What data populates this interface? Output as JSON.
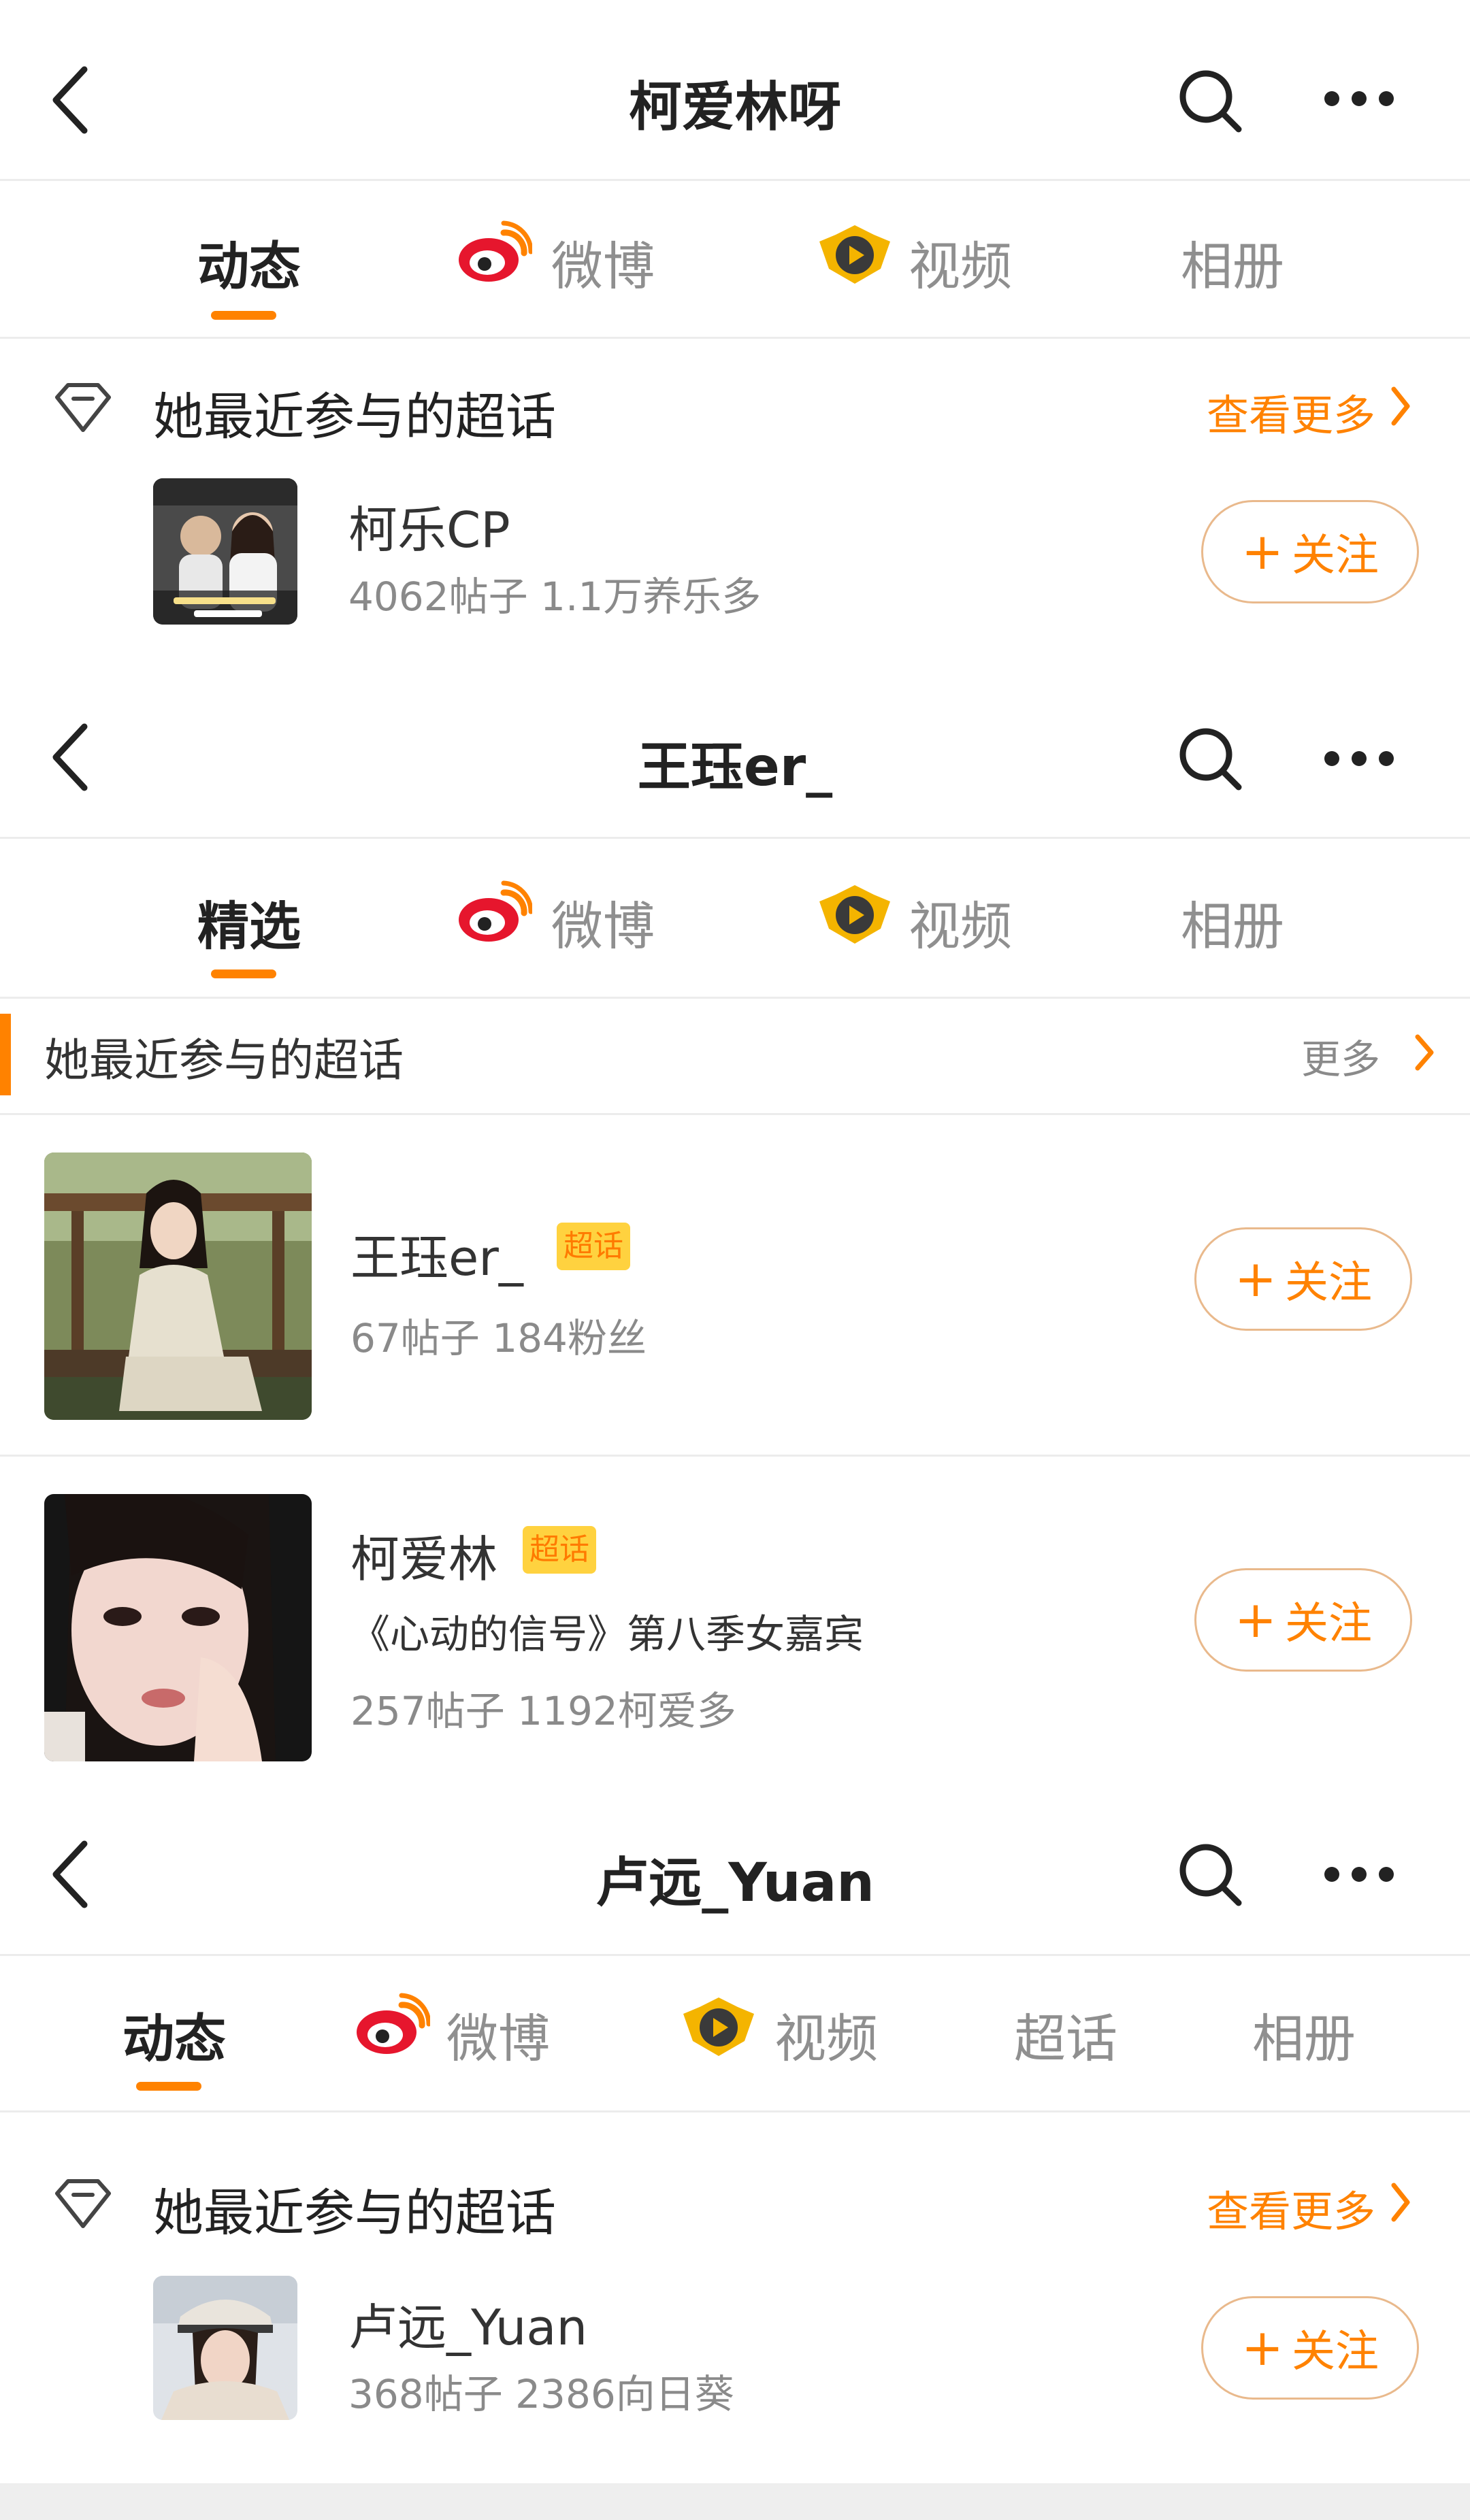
{
  "panel1": {
    "title": "柯爱林呀",
    "tabs": [
      {
        "label": "动态"
      },
      {
        "label": "微博"
      },
      {
        "label": "视频"
      },
      {
        "label": "相册"
      }
    ],
    "section_title": "她最近参与的超话",
    "more_label": "查看更多",
    "item": {
      "name": "柯乐CP",
      "meta": "4062帖子 1.1万养乐多",
      "follow_label": "关注"
    }
  },
  "panel2": {
    "title": "王珏er_",
    "tabs": [
      {
        "label": "精选"
      },
      {
        "label": "微博"
      },
      {
        "label": "视频"
      },
      {
        "label": "相册"
      }
    ],
    "section_title": "她最近参与的超话",
    "more_label": "更多",
    "items": [
      {
        "name": "王珏er_",
        "badge": "超话",
        "meta": "67帖子 184粉丝",
        "follow_label": "关注"
      },
      {
        "name": "柯爱林",
        "badge": "超话",
        "desc": "《心动的信号》第八季女嘉宾",
        "meta": "257帖子 1192柯爱多",
        "follow_label": "关注"
      }
    ]
  },
  "panel3": {
    "title": "卢远_Yuan",
    "tabs": [
      {
        "label": "动态"
      },
      {
        "label": "微博"
      },
      {
        "label": "视频"
      },
      {
        "label": "超话"
      },
      {
        "label": "相册"
      }
    ],
    "section_title": "她最近参与的超话",
    "more_label": "查看更多",
    "item": {
      "name": "卢远_Yuan",
      "meta": "368帖子 2386向日葵",
      "follow_label": "关注"
    }
  },
  "colors": {
    "accent": "#ff8200",
    "badge": "#ffd23f",
    "text": "#222222",
    "muted": "#8a8a8a"
  },
  "icons": [
    "back-icon",
    "search-icon",
    "more-icon",
    "weibo-icon",
    "video-icon",
    "diamond-icon",
    "chevron-right-icon"
  ]
}
